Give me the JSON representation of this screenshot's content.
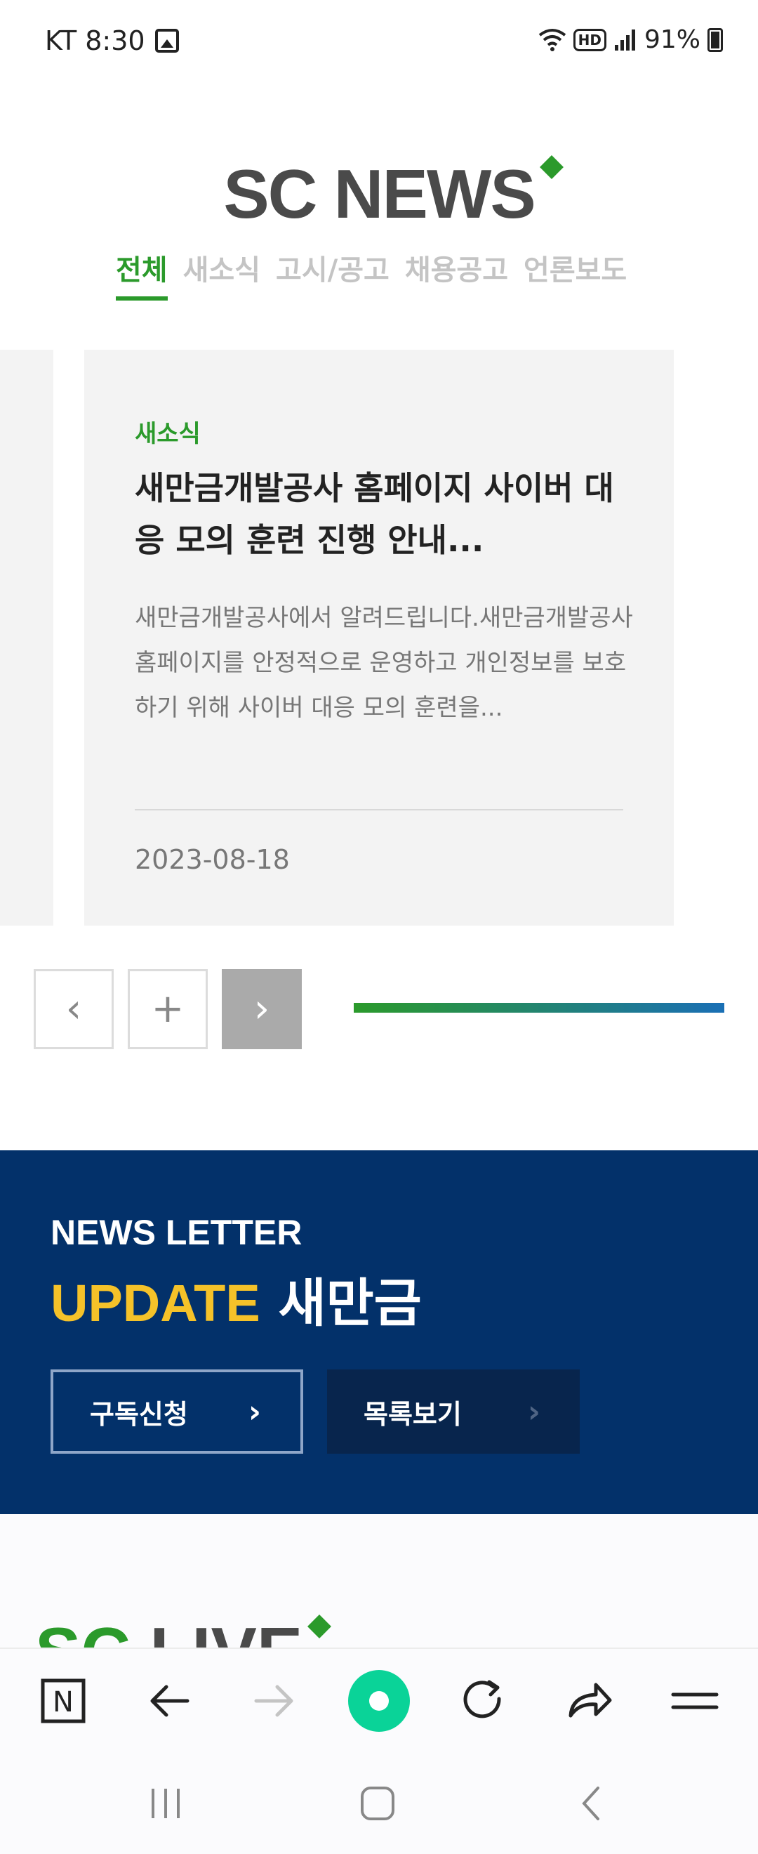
{
  "status_bar": {
    "carrier_time": "KT 8:30",
    "hd": "HD",
    "battery": "91%",
    "icons": [
      "gallery-icon",
      "wifi-icon",
      "signal-icon",
      "battery-icon"
    ]
  },
  "header": {
    "title": "SC NEWS"
  },
  "tabs": [
    {
      "label": "전체",
      "active": true
    },
    {
      "label": "새소식",
      "active": false
    },
    {
      "label": "고시/공고",
      "active": false
    },
    {
      "label": "채용공고",
      "active": false
    },
    {
      "label": "언론보도",
      "active": false
    }
  ],
  "card": {
    "category": "새소식",
    "title": "새만금개발공사 홈페이지 사이버 대응 모의 훈련 진행 안내...",
    "description": "새만금개발공사에서 알려드립니다.새만금개발공사 홈페이지를 안정적으로 운영하고 개인정보를 보호하기 위해 사이버 대응 모의 훈련을...",
    "date": "2023-08-18"
  },
  "controls": {
    "prev_icon": "‹",
    "more_icon": "+",
    "next_icon": "›",
    "progress": 1.0
  },
  "newsletter": {
    "label": "NEWS LETTER",
    "title_accent": "UPDATE",
    "title_rest": " 새만금",
    "subscribe_label": "구독신청",
    "list_label": "목록보기",
    "chevron": "›"
  },
  "live": {
    "title_green": "SC",
    "title_rest": " LIVE"
  },
  "toolbar": {
    "icons": [
      "naver-n-icon",
      "back-arrow-icon",
      "forward-arrow-icon",
      "green-dot-icon",
      "refresh-icon",
      "share-icon",
      "menu-icon"
    ],
    "naver_letter": "N"
  },
  "colors": {
    "brand_green": "#2b9a2b",
    "navy": "#03316a",
    "accent_yellow": "#f5c229",
    "progress_blue": "#1a6fb5"
  }
}
